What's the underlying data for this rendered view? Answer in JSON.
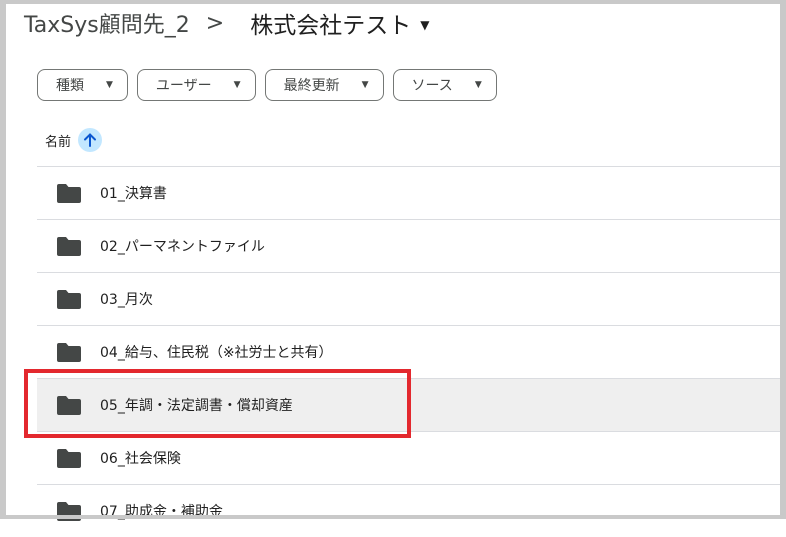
{
  "breadcrumb": {
    "root": "TaxSys顧問先_2",
    "separator": ">",
    "current": "株式会社テスト",
    "current_caret": "▼"
  },
  "filters": [
    {
      "label": "種類",
      "caret": "▼"
    },
    {
      "label": "ユーザー",
      "caret": "▼"
    },
    {
      "label": "最終更新",
      "caret": "▼"
    },
    {
      "label": "ソース",
      "caret": "▼"
    }
  ],
  "columns": {
    "name_header": "名前",
    "sort_icon": "arrow-up-icon"
  },
  "folders": [
    {
      "name": "01_決算書"
    },
    {
      "name": "02_パーマネントファイル"
    },
    {
      "name": "03_月次"
    },
    {
      "name": "04_給与、住民税（※社労士と共有）"
    },
    {
      "name": "05_年調・法定調書・償却資産",
      "highlighted": true
    },
    {
      "name": "06_社会保険"
    },
    {
      "name": "07_助成金・補助金"
    }
  ],
  "colors": {
    "annotation": "#e3282e",
    "sort_bg": "#c2e7ff",
    "highlight_row": "#efefef"
  }
}
